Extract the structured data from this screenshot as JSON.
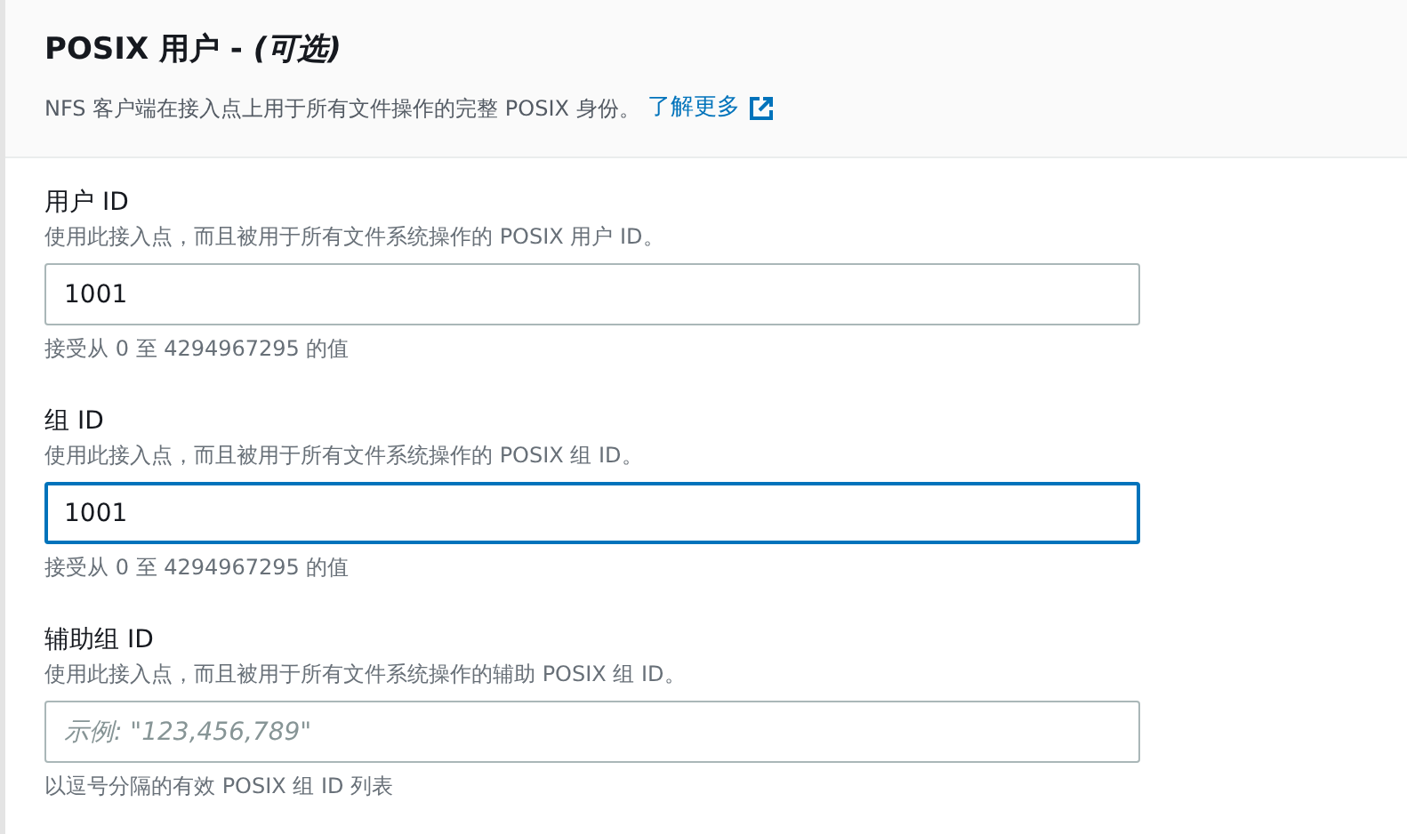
{
  "header": {
    "title": "POSIX 用户 - ",
    "title_optional": "(可选)",
    "description": "NFS 客户端在接入点上用于所有文件操作的完整 POSIX 身份。",
    "link": "了解更多"
  },
  "fields": [
    {
      "label": "用户 ID",
      "description": "使用此接入点，而且被用于所有文件系统操作的 POSIX 用户 ID。",
      "value": "1001",
      "focused": false,
      "constraint": "接受从 0 至 4294967295 的值"
    },
    {
      "label": "组 ID",
      "description": "使用此接入点，而且被用于所有文件系统操作的 POSIX 组 ID。",
      "value": "1001",
      "focused": true,
      "constraint": "接受从 0 至 4294967295 的值"
    },
    {
      "label": "辅助组 ID",
      "description": "使用此接入点，而且被用于所有文件系统操作的辅助 POSIX 组 ID。",
      "placeholder": "示例: \"123,456,789\"",
      "focused": false,
      "constraint": "以逗号分隔的有效 POSIX 组 ID 列表"
    }
  ]
}
